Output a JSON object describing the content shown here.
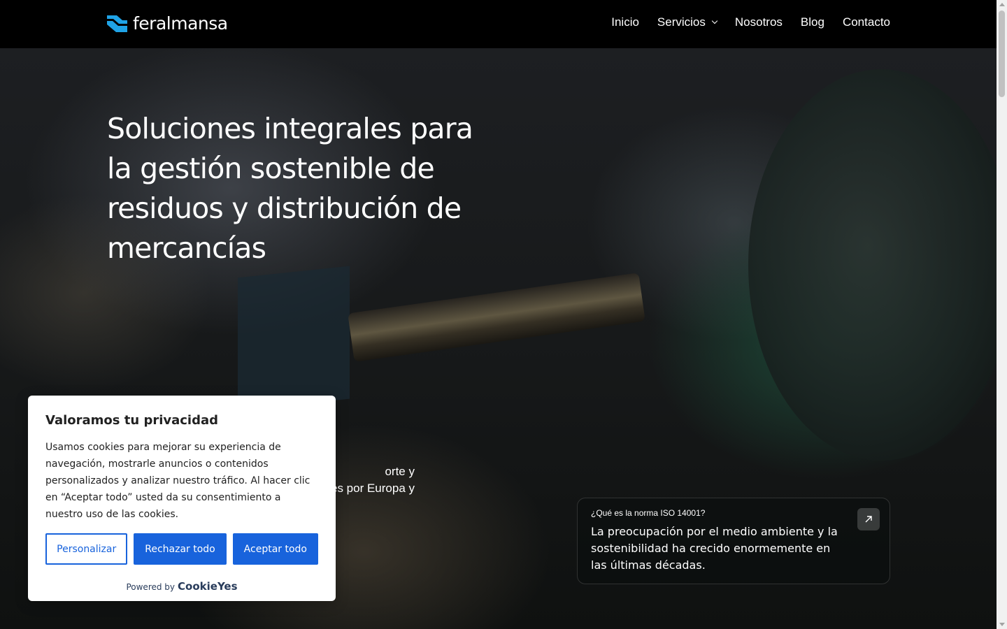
{
  "header": {
    "logo_text": "feralmansa",
    "nav": [
      {
        "label": "Inicio"
      },
      {
        "label": "Servicios"
      },
      {
        "label": "Nosotros"
      },
      {
        "label": "Blog"
      },
      {
        "label": "Contacto"
      }
    ]
  },
  "hero": {
    "headline": "Soluciones integrales para la gestión sostenible de residuos y distribución de mercancías",
    "paragraph_visible": "orte y\nes por Europa y"
  },
  "info_card": {
    "kicker": "¿Qué es la norma ISO 14001?",
    "text": "La preocupación por el medio ambiente y la sostenibilidad ha crecido enormemente en las últimas décadas.",
    "button_icon": "arrow-up-right-icon"
  },
  "cookie_banner": {
    "title": "Valoramos tu privacidad",
    "body": "Usamos cookies para mejorar su experiencia de navegación, mostrarle anuncios o contenidos personalizados y analizar nuestro tráfico. Al hacer clic en “Aceptar todo” usted da su consentimiento a nuestro uso de las cookies.",
    "buttons": {
      "customize": "Personalizar",
      "reject": "Rechazar todo",
      "accept": "Aceptar todo"
    },
    "powered_by": "Powered by",
    "powered_brand": "CookieYes",
    "accent_color": "#1863dc"
  },
  "colors": {
    "header_bg": "#000000",
    "logo_accent": "#1fa3e6"
  }
}
